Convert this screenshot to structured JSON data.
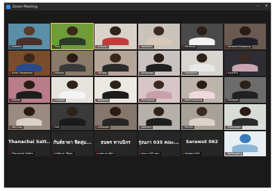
{
  "window": {
    "title": "Zoom Meeting",
    "controls": [
      "–",
      "×"
    ]
  },
  "tiles": [
    {
      "name": "Duaniku",
      "kind": "video",
      "bg": "#5b8fa8",
      "head": "#5a3a2a",
      "body": "#4b2f2a"
    },
    {
      "name": "Ploy",
      "kind": "video",
      "bg": "#6f9c3a",
      "head": "#3a2818",
      "body": "#2d3a2a",
      "speaking": true
    },
    {
      "name": "Jirayuth",
      "kind": "video",
      "bg": "#d9d2c8",
      "head": "#2e231d",
      "body": "#c23a3a"
    },
    {
      "name": "Nattawut",
      "kind": "video",
      "bg": "#c9c3bb",
      "head": "#3a2a22",
      "body": "#d8c8b8"
    },
    {
      "name": "Kittipong",
      "kind": "video",
      "bg": "#4a4a4a",
      "head": "#2b2019",
      "body": "#f2f2f2"
    },
    {
      "name": "Sarawut Khaopang",
      "kind": "video",
      "bg": "#6b5a50",
      "head": "#2a1d15",
      "body": "#1f1f2a"
    },
    {
      "name": "Suwit Sangtawan",
      "kind": "video",
      "bg": "#7a4c2c",
      "head": "#3a281c",
      "body": "#2a4a8a"
    },
    {
      "name": "Namtip",
      "kind": "video",
      "bg": "#8a7a6a",
      "head": "#2a1c14",
      "body": "#3a3a3a"
    },
    {
      "name": "Patipan",
      "kind": "video",
      "bg": "#b6a69a",
      "head": "#3a281c",
      "body": "#2b2b2b"
    },
    {
      "name": "Kanokwan",
      "kind": "video",
      "bg": "#c8c2c0",
      "head": "#2a1e18",
      "body": "#202020"
    },
    {
      "name": "Thanakorn",
      "kind": "video",
      "bg": "#d8d4cf",
      "head": "#2e221b",
      "body": "#e8e8e8"
    },
    {
      "name": "Supattra",
      "kind": "video",
      "bg": "#2d2d33",
      "head": "#3a2a22",
      "body": "#c9a6b0"
    },
    {
      "name": "Panida",
      "kind": "video",
      "bg": "#b87c8a",
      "head": "#2a1d16",
      "body": "#1d1d1d"
    },
    {
      "name": "Chaiwat",
      "kind": "video",
      "bg": "#e6e3dd",
      "head": "#2f231b",
      "body": "#f4f4f4"
    },
    {
      "name": "Kiattisak",
      "kind": "video",
      "bg": "#ece9e4",
      "head": "#2e231c",
      "body": "#1c1c1c"
    },
    {
      "name": "Pimchanok",
      "kind": "video",
      "bg": "#d9c5c8",
      "head": "#3a2a22",
      "body": "#c8a0a8"
    },
    {
      "name": "Watcharapong",
      "kind": "video",
      "bg": "#bdb4ab",
      "head": "#2a1d16",
      "body": "#f0d8dc"
    },
    {
      "name": "Teerapat",
      "kind": "video",
      "bg": "#6c6c6c",
      "head": "#2c2019",
      "body": "#222222"
    },
    {
      "name": "Wannisa",
      "kind": "video",
      "bg": "#9a8a80",
      "head": "#2a1c14",
      "body": "#d9d0c8"
    },
    {
      "name": "Nut",
      "kind": "video",
      "bg": "#3a3a3a",
      "head": "#2e221a",
      "body": "#1b1b1b"
    },
    {
      "name": "Jakkapan",
      "kind": "video",
      "bg": "#85776b",
      "head": "#2a1d16",
      "body": "#262626"
    },
    {
      "name": "Apichart",
      "kind": "video",
      "bg": "#b5b0aa",
      "head": "#2f231b",
      "body": "#1e1e1e"
    },
    {
      "name": "Sirinya",
      "kind": "video",
      "bg": "#a8a19a",
      "head": "#3a2a22",
      "body": "#ddd2c8"
    },
    {
      "name": "Phatcharin",
      "kind": "video",
      "bg": "#d8dcd8",
      "head": "#2a1d16",
      "body": "#2a2a2a"
    },
    {
      "name": "Thanachai Satt...",
      "kind": "nameonly",
      "plate": "Thanachai Sattha"
    },
    {
      "name": "กันต์ธาดา ฟิตลุ่ม...",
      "kind": "nameonly",
      "plate": "กันต์ธาดา ฟิตลุ่ม"
    },
    {
      "name": "ธนพร ทานนิกร",
      "kind": "nameonly",
      "plate": "ธนพร ทานนิกร"
    },
    {
      "name": "รุ่งนภา 035 คณะ...",
      "kind": "nameonly",
      "plate": "รุ่งนภา 035 คณะ"
    },
    {
      "name": "Sarawut 062",
      "kind": "nameonly",
      "plate": "Sarawut 062"
    },
    {
      "name": "Natthapong",
      "kind": "video",
      "bg": "#e9eef2",
      "head": "#3a7ab8",
      "body": "#8ab8d8"
    }
  ]
}
